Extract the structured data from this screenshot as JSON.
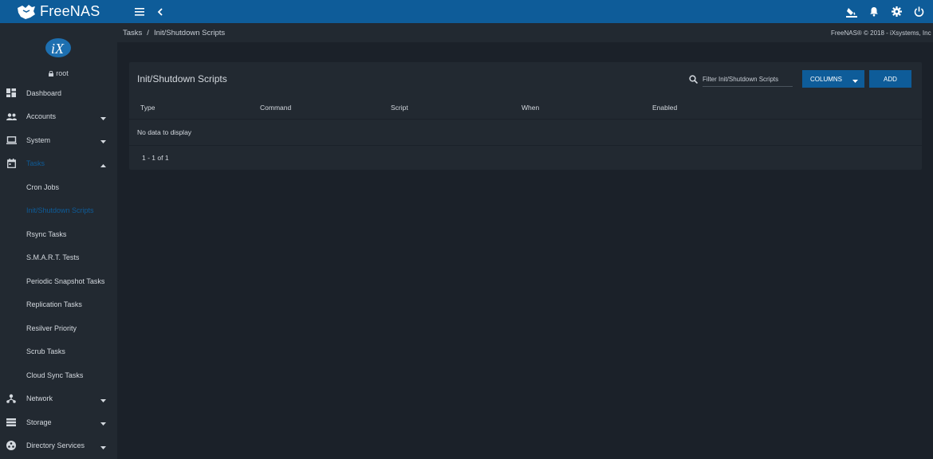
{
  "brand": {
    "name": "FreeNAS"
  },
  "user": {
    "name": "root"
  },
  "breadcrumb": {
    "parent": "Tasks",
    "separator": "/",
    "current": "Init/Shutdown Scripts"
  },
  "copyright": "FreeNAS® © 2018 - iXsystems, Inc",
  "sidebar": {
    "items": [
      {
        "label": "Dashboard",
        "icon": "dashboard-icon"
      },
      {
        "label": "Accounts",
        "icon": "people-icon"
      },
      {
        "label": "System",
        "icon": "laptop-icon"
      },
      {
        "label": "Tasks",
        "icon": "calendar-icon"
      },
      {
        "label": "Network",
        "icon": "network-icon"
      },
      {
        "label": "Storage",
        "icon": "storage-icon"
      },
      {
        "label": "Directory Services",
        "icon": "directory-icon"
      }
    ],
    "tasks_sub": [
      "Cron Jobs",
      "Init/Shutdown Scripts",
      "Rsync Tasks",
      "S.M.A.R.T. Tests",
      "Periodic Snapshot Tasks",
      "Replication Tasks",
      "Resilver Priority",
      "Scrub Tasks",
      "Cloud Sync Tasks"
    ]
  },
  "card": {
    "title": "Init/Shutdown Scripts",
    "filter_placeholder": "Filter Init/Shutdown Scripts",
    "columns_label": "COLUMNS",
    "add_label": "ADD",
    "headers": [
      "Type",
      "Command",
      "Script",
      "When",
      "Enabled"
    ],
    "empty_text": "No data to display",
    "pagination": "1 - 1 of 1"
  },
  "colors": {
    "accent": "#0e5c99",
    "background": "#1b2129",
    "panel": "#222931"
  }
}
